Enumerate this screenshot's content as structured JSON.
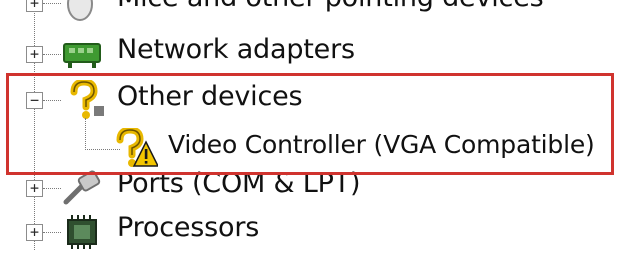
{
  "device_tree": {
    "items": [
      {
        "label": "Mice and other pointing devices",
        "expander": "+",
        "icon": "mouse-icon"
      },
      {
        "label": "Network adapters",
        "expander": "+",
        "icon": "network-adapter-icon"
      },
      {
        "label": "Other devices",
        "expander": "−",
        "icon": "unknown-device-icon"
      },
      {
        "label": "Video Controller (VGA Compatible)",
        "expander": "",
        "icon": "unknown-device-warning-icon"
      },
      {
        "label": "Ports (COM & LPT)",
        "expander": "+",
        "icon": "port-icon"
      },
      {
        "label": "Processors",
        "expander": "+",
        "icon": "processor-icon"
      }
    ]
  },
  "colors": {
    "highlight_border": "#d0332e",
    "network_icon": "#3f9a31",
    "warning_yellow": "#f2c500"
  }
}
